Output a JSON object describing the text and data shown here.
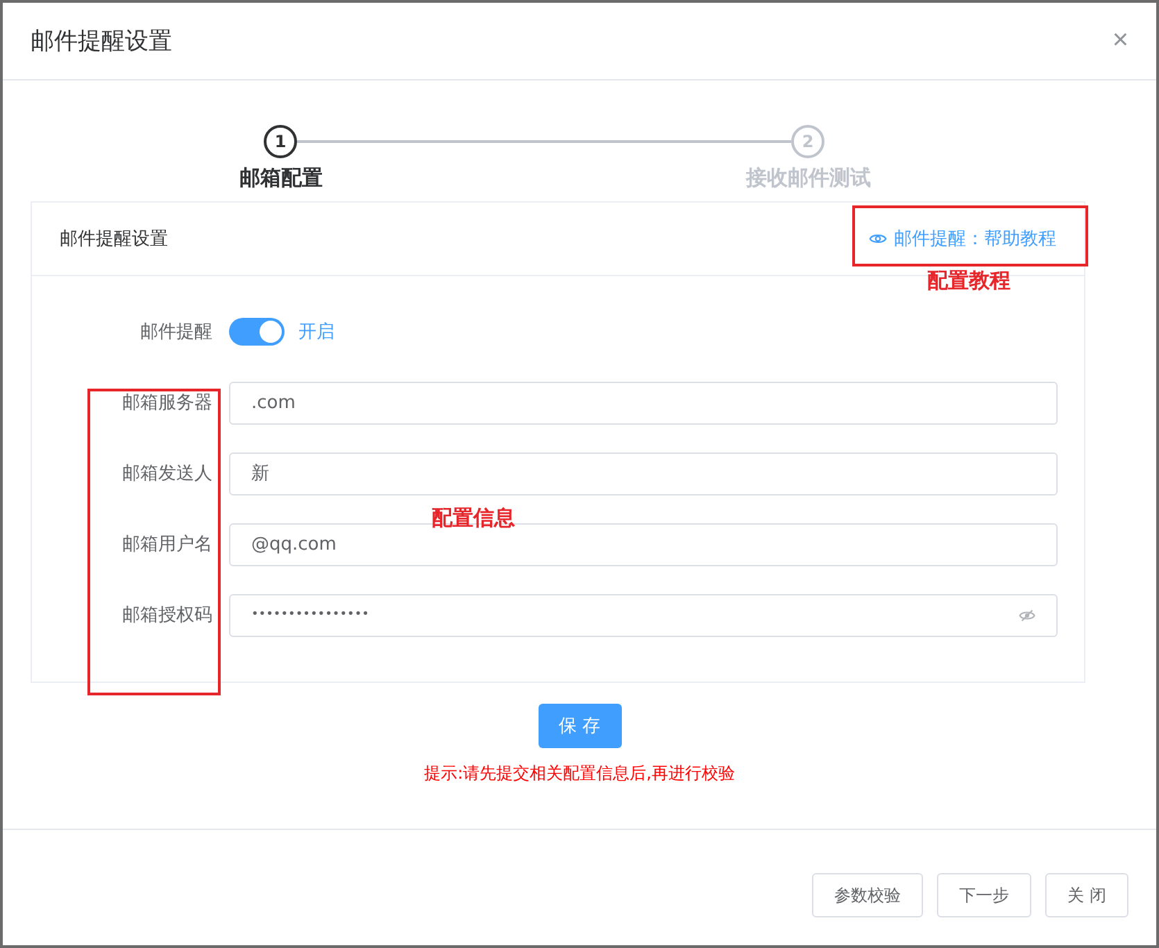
{
  "dialog": {
    "title": "邮件提醒设置",
    "close": "×"
  },
  "steps": [
    {
      "number": "1",
      "label": "邮箱配置",
      "selected": true
    },
    {
      "number": "2",
      "label": "接收邮件测试",
      "selected": false
    }
  ],
  "card": {
    "title": "邮件提醒设置",
    "help_link": "邮件提醒：帮助教程"
  },
  "toggle": {
    "label": "邮件提醒",
    "on": true,
    "text": "开启"
  },
  "fields": [
    {
      "label": "邮箱服务器",
      "value": ".com",
      "kind": "text"
    },
    {
      "label": "邮箱发送人",
      "value": "新",
      "kind": "text"
    },
    {
      "label": "邮箱用户名",
      "value": "@qq.com",
      "kind": "text"
    },
    {
      "label": "邮箱授权码",
      "value": "••••••••••••••••",
      "kind": "password"
    }
  ],
  "save_button": "保 存",
  "hint": "提示:请先提交相关配置信息后,再进行校验",
  "footer_buttons": [
    "参数校验",
    "下一步",
    "关 闭"
  ],
  "annotations": [
    {
      "kind": "help",
      "text": "配置教程"
    },
    {
      "kind": "labels",
      "text": "配置信息"
    }
  ]
}
